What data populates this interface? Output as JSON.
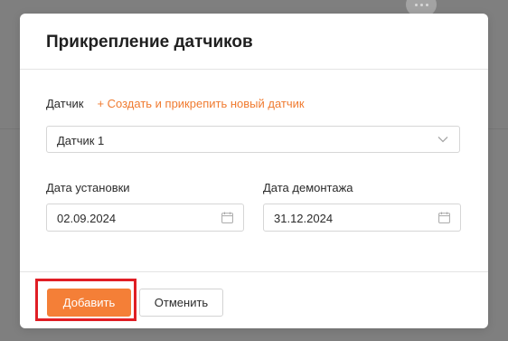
{
  "modal": {
    "title": "Прикрепление датчиков",
    "sensor_label": "Датчик",
    "create_link": "+ Создать и прикрепить новый датчик",
    "sensor_select_value": "Датчик 1",
    "install_date_label": "Дата установки",
    "install_date_value": "02.09.2024",
    "removal_date_label": "Дата демонтажа",
    "removal_date_value": "31.12.2024",
    "add_button": "Добавить",
    "cancel_button": "Отменить"
  },
  "icons": {
    "select_chevron": "chevron-down-icon",
    "install_date_icon": "calendar-icon",
    "removal_date_icon": "calendar-icon",
    "background_chat": "chat-bubble-icon"
  },
  "colors": {
    "accent": "#f47f37",
    "link": "#f07b30",
    "highlight": "#e01e25",
    "overlay": "#7f7f7f"
  }
}
